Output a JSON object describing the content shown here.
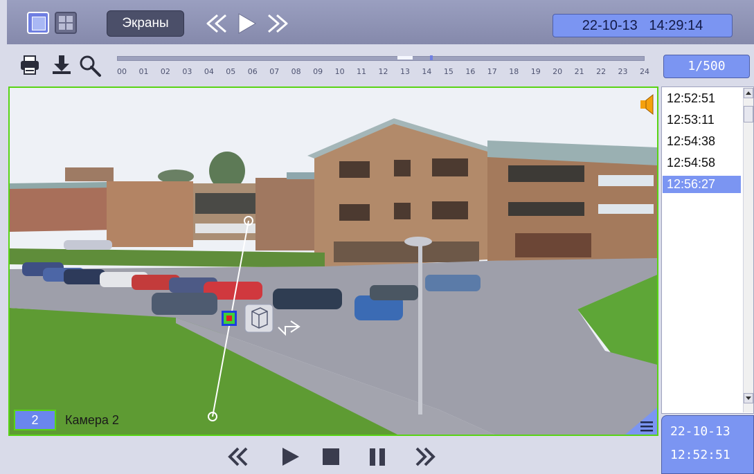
{
  "topbar": {
    "screens_label": "Экраны",
    "datetime": "22-10-13   14:29:14"
  },
  "timeline": {
    "hours": [
      "00",
      "01",
      "02",
      "03",
      "04",
      "05",
      "06",
      "07",
      "08",
      "09",
      "10",
      "11",
      "12",
      "13",
      "14",
      "15",
      "16",
      "17",
      "18",
      "19",
      "20",
      "21",
      "22",
      "23",
      "24"
    ]
  },
  "counter": "1/500",
  "camera": {
    "number": "2",
    "name": "Камера 2"
  },
  "events": [
    {
      "time": "12:52:51",
      "selected": false
    },
    {
      "time": "12:53:11",
      "selected": false
    },
    {
      "time": "12:54:38",
      "selected": false
    },
    {
      "time": "12:54:58",
      "selected": false
    },
    {
      "time": "12:56:27",
      "selected": true
    }
  ],
  "bottom": {
    "date": "22-10-13",
    "time": "12:52:51"
  },
  "icons": {
    "layout_single": "single-layout-icon",
    "layout_quad": "quad-layout-icon",
    "print": "printer-icon",
    "download": "download-icon",
    "search": "magnifier-icon",
    "speaker": "speaker-icon",
    "menu": "menu-icon"
  },
  "colors": {
    "accent": "#7b95f2",
    "frame_border": "#58d414",
    "topbar": "#8f93b3"
  }
}
